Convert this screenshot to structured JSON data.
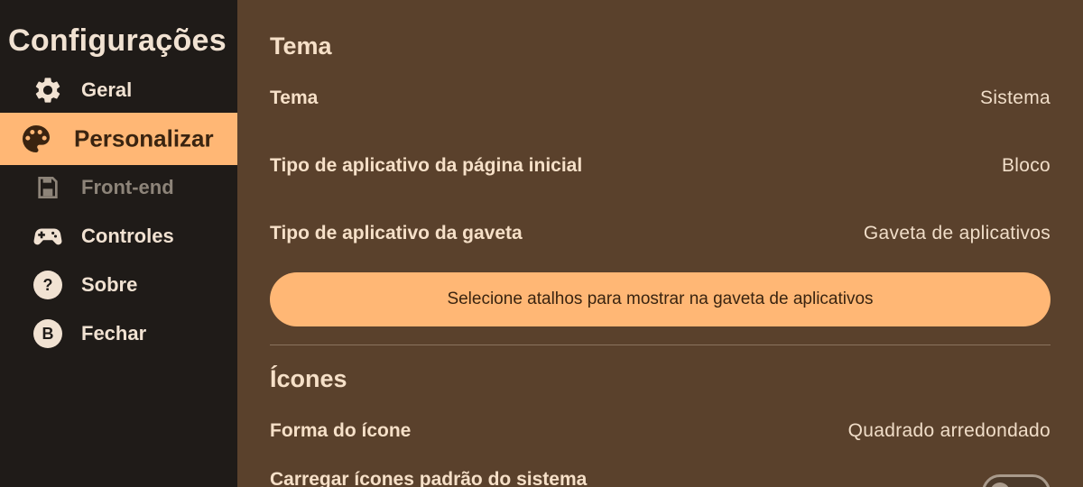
{
  "sidebar": {
    "title": "Configurações",
    "items": [
      {
        "label": "Geral",
        "icon": "gear-icon"
      },
      {
        "label": "Personalizar",
        "icon": "palette-icon",
        "active": true
      },
      {
        "label": "Front-end",
        "icon": "save-icon",
        "disabled": true
      },
      {
        "label": "Controles",
        "icon": "gamepad-icon"
      },
      {
        "label": "Sobre",
        "icon": "question-icon",
        "glyph": "?"
      },
      {
        "label": "Fechar",
        "icon": "b-button-icon",
        "glyph": "B"
      }
    ]
  },
  "sections": {
    "theme": {
      "title": "Tema",
      "rows": [
        {
          "label": "Tema",
          "value": "Sistema"
        },
        {
          "label": "Tipo de aplicativo da página inicial",
          "value": "Bloco"
        },
        {
          "label": "Tipo de aplicativo da gaveta",
          "value": "Gaveta de aplicativos"
        }
      ],
      "shortcut_button": "Selecione atalhos para mostrar na gaveta de aplicativos"
    },
    "icons": {
      "title": "Ícones",
      "rows": [
        {
          "label": "Forma do ícone",
          "value": "Quadrado arredondado"
        },
        {
          "label": "Carregar ícones padrão do sistema"
        }
      ]
    }
  },
  "colors": {
    "background": "#5a412c",
    "sidebar": "#1f1b18",
    "accent": "#ffb775",
    "text": "#f6e0c8"
  }
}
